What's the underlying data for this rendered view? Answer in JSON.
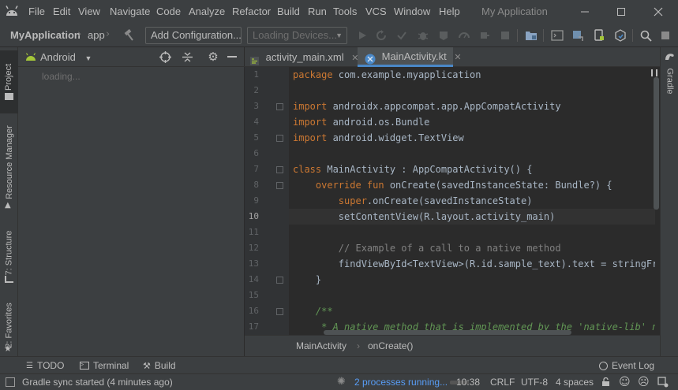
{
  "menu": {
    "items": [
      "File",
      "Edit",
      "View",
      "Navigate",
      "Code",
      "Analyze",
      "Refactor",
      "Build",
      "Run",
      "Tools",
      "VCS",
      "Window",
      "Help"
    ],
    "app_title": "My Application",
    "icons": [
      "android-logo-icon",
      "minimize-icon",
      "maximize-icon",
      "close-icon"
    ]
  },
  "toolbar": {
    "project": "MyApplication",
    "module": "app",
    "run_config": "Add Configuration...",
    "device_placeholder": "Loading Devices...",
    "icons": [
      "hammer-icon",
      "run-icon",
      "rerun-icon",
      "debug-icon",
      "profile-icon",
      "coverage-icon",
      "attach-debugger-icon",
      "stop-icon",
      "project-structure-icon",
      "avd-manager-icon",
      "sdk-manager-icon",
      "sync-project-icon",
      "search-icon",
      "stop-build-icon"
    ]
  },
  "left_strip": {
    "tabs": [
      "1: Project",
      "Resource Manager",
      "7: Structure",
      "2: Favorites"
    ]
  },
  "right_strip": {
    "tabs": [
      "Gradle"
    ]
  },
  "project_panel": {
    "view": "Android",
    "loading": "loading..."
  },
  "editor": {
    "tabs": [
      {
        "label": "activity_main.xml",
        "active": false
      },
      {
        "label": "MainActivity.kt",
        "active": true
      }
    ],
    "current_line": 10,
    "lines": [
      {
        "n": "1",
        "parts": [
          {
            "t": "package ",
            "c": "kw"
          },
          {
            "t": "com.example.myapplication",
            "c": ""
          }
        ]
      },
      {
        "n": "2",
        "parts": []
      },
      {
        "n": "3",
        "parts": [
          {
            "t": "import ",
            "c": "kw"
          },
          {
            "t": "androidx.appcompat.app.AppCompatActivity",
            "c": ""
          }
        ]
      },
      {
        "n": "4",
        "parts": [
          {
            "t": "import ",
            "c": "kw"
          },
          {
            "t": "android.os.Bundle",
            "c": ""
          }
        ]
      },
      {
        "n": "5",
        "parts": [
          {
            "t": "import ",
            "c": "kw"
          },
          {
            "t": "android.widget.TextView",
            "c": ""
          }
        ]
      },
      {
        "n": "6",
        "parts": []
      },
      {
        "n": "7",
        "parts": [
          {
            "t": "class ",
            "c": "kw"
          },
          {
            "t": "MainActivity : AppCompatActivity() {",
            "c": ""
          }
        ]
      },
      {
        "n": "8",
        "parts": [
          {
            "t": "    override fun ",
            "c": "kw"
          },
          {
            "t": "onCreate(savedInstanceState: Bundle?) {",
            "c": ""
          }
        ]
      },
      {
        "n": "9",
        "parts": [
          {
            "t": "        super",
            "c": "kw"
          },
          {
            "t": ".onCreate(savedInstanceState)",
            "c": ""
          }
        ]
      },
      {
        "n": "10",
        "parts": [
          {
            "t": "        setContentView(R.layout.activity_main)",
            "c": ""
          }
        ]
      },
      {
        "n": "11",
        "parts": []
      },
      {
        "n": "12",
        "parts": [
          {
            "t": "        // Example of a call to a native method",
            "c": "cm"
          }
        ]
      },
      {
        "n": "13",
        "parts": [
          {
            "t": "        findViewById<TextView>(R.id.sample_text).text = stringFromJNI()",
            "c": ""
          }
        ]
      },
      {
        "n": "14",
        "parts": [
          {
            "t": "    }",
            "c": ""
          }
        ]
      },
      {
        "n": "15",
        "parts": []
      },
      {
        "n": "16",
        "parts": [
          {
            "t": "    /**",
            "c": "doc"
          }
        ]
      },
      {
        "n": "17",
        "parts": [
          {
            "t": "     * A native method that is implemented by the 'native-lib' native library,",
            "c": "doc"
          }
        ]
      }
    ],
    "breadcrumb": [
      "MainActivity",
      "onCreate()"
    ]
  },
  "bottom_tabs": {
    "items": [
      "TODO",
      "Terminal",
      "Build"
    ],
    "event_log": "Event Log"
  },
  "status": {
    "message": "Gradle sync started (4 minutes ago)",
    "processes": "2 processes running...",
    "position": "10:38",
    "line_sep": "CRLF",
    "encoding": "UTF-8",
    "indent": "4 spaces"
  },
  "colors": {
    "accent": "#4a88c7",
    "keyword": "#cc7832",
    "comment": "#808080",
    "doc_comment": "#629755",
    "text": "#a9b7c6",
    "android_green": "#a4c639"
  }
}
